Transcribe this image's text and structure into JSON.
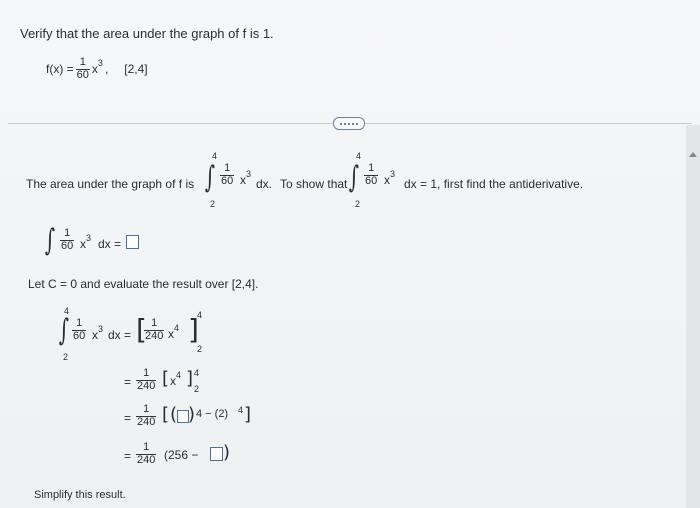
{
  "question": {
    "instruction": "Verify that the area under the graph of f is 1.",
    "function_lhs": "f(x) =",
    "coef_num": "1",
    "coef_den": "60",
    "variable": "x",
    "power": "3",
    "comma": ",",
    "interval": "[2,4]"
  },
  "toolbar": {
    "more_label": "....."
  },
  "part": {
    "area_text": "The area under the graph of f is",
    "dx": "dx.",
    "to_show_text": "To show that",
    "equals_one_text": "dx = 1, first find the antiderivative.",
    "lower": "2",
    "upper": "4",
    "antideriv_dx": "dx =",
    "let_text": "Let C = 0 and evaluate the result over [2,4].",
    "eval_coef_num": "1",
    "eval_coef_den": "240",
    "power4": "4",
    "line3_rest": "4 − (2)",
    "line4_left": "(256 −",
    "simplify_text": "Simplify this result."
  }
}
